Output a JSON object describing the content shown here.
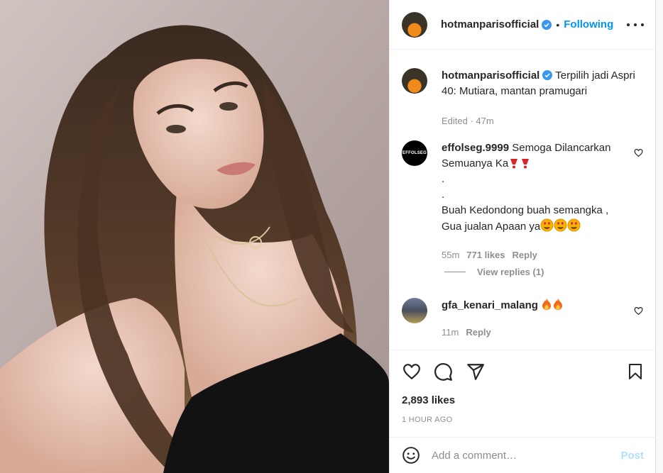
{
  "header": {
    "username": "hotmanparisofficial",
    "separator": "•",
    "follow_status": "Following"
  },
  "caption": {
    "username": "hotmanparisofficial",
    "text": "Terpilih jadi Aspri 40: Mutiara, mantan pramugari",
    "meta": "Edited · 47m"
  },
  "comments": [
    {
      "username": "effolseg.9999",
      "avatar_text": "EFFOLSEG",
      "lines": [
        "Semoga Dilancarkan Semuanya Ka",
        ".",
        ".",
        "Buah Kedondong buah semangka ,",
        "Gua jualan Apaan ya"
      ],
      "time": "55m",
      "likes": "771 likes",
      "reply": "Reply",
      "view_replies": "View replies (1)"
    },
    {
      "username": "gfa_kenari_malang",
      "time": "11m",
      "reply": "Reply"
    }
  ],
  "likes": "2,893 likes",
  "time_ago": "1 HOUR AGO",
  "comment_box": {
    "placeholder": "Add a comment…",
    "post_label": "Post"
  },
  "colors": {
    "accent": "#0095f6",
    "post_disabled": "#b2dffc",
    "secondary_text": "#8e8e8e",
    "verified": "#3897f0"
  },
  "icons": {
    "heart": "heart-icon",
    "comment": "comment-icon",
    "share": "paper-plane-icon",
    "save": "bookmark-icon",
    "emoji": "smiley-icon",
    "more": "more-options-icon",
    "verified": "verified-badge-icon"
  }
}
